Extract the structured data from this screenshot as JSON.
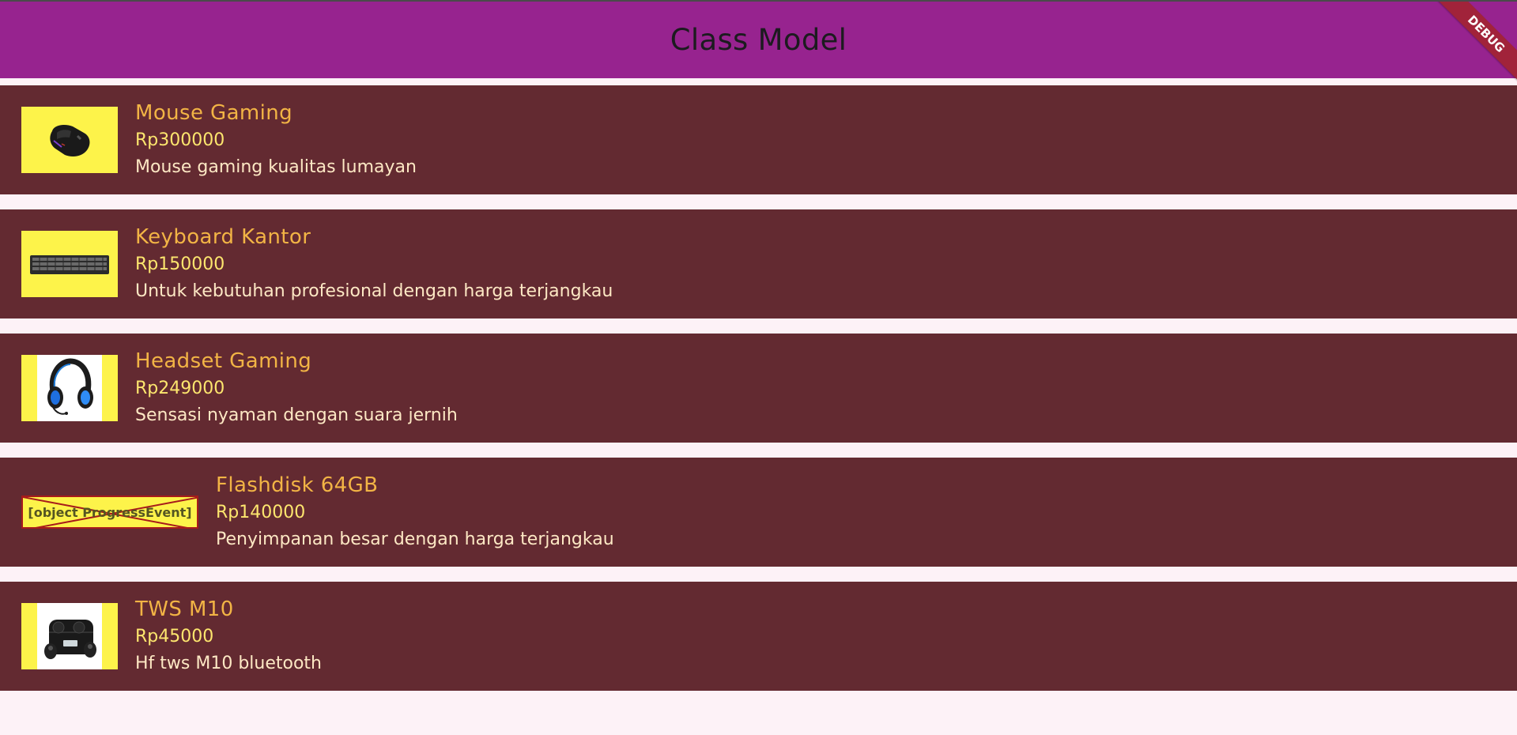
{
  "appbar": {
    "title": "Class Model",
    "background": "#97238f",
    "debug_label": "DEBUG"
  },
  "colors": {
    "card_background": "#632a31",
    "name_color": "#f2b445",
    "price_color": "#fde66e",
    "desc_color": "#fde8c4",
    "thumb_background": "#fdf34a",
    "page_background": "#fdf2f7"
  },
  "products": [
    {
      "name": "Mouse Gaming",
      "price": "Rp300000",
      "description": "Mouse gaming kualitas lumayan",
      "image_icon": "mouse-image"
    },
    {
      "name": "Keyboard Kantor",
      "price": "Rp150000",
      "description": "Untuk kebutuhan profesional dengan harga terjangkau",
      "image_icon": "keyboard-image"
    },
    {
      "name": "Headset Gaming",
      "price": "Rp249000",
      "description": "Sensasi nyaman dengan suara jernih",
      "image_icon": "headset-image"
    },
    {
      "name": "Flashdisk 64GB",
      "price": "Rp140000",
      "description": "Penyimpanan besar dengan harga terjangkau",
      "image_icon": "image-error-placeholder",
      "image_error_text": "[object ProgressEvent]"
    },
    {
      "name": "TWS M10",
      "price": "Rp45000",
      "description": "Hf tws M10 bluetooth",
      "image_icon": "earbuds-image"
    }
  ]
}
